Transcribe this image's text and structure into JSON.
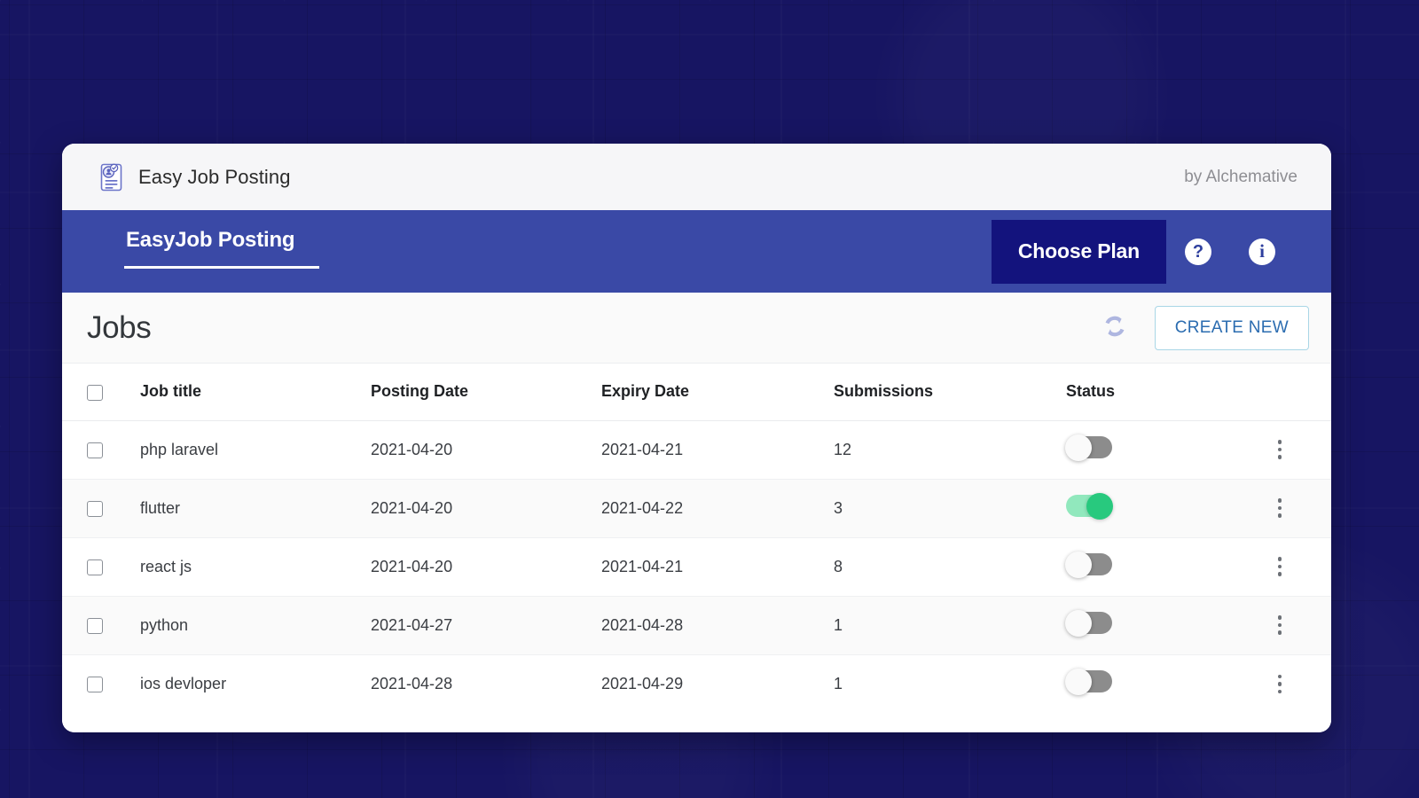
{
  "brand": {
    "logo_icon": "resume-document-icon",
    "app_name": "Easy Job Posting",
    "attribution": "by Alchemative"
  },
  "nav": {
    "active_tab": "EasyJob Posting",
    "choose_plan_label": "Choose Plan",
    "help_icon": "question-mark-icon",
    "help_glyph": "?",
    "info_icon": "info-icon",
    "info_glyph": "i"
  },
  "page": {
    "title": "Jobs",
    "refresh_icon": "refresh-icon",
    "create_label": "CREATE NEW"
  },
  "table": {
    "columns": [
      {
        "key": "select",
        "label": ""
      },
      {
        "key": "title",
        "label": "Job title"
      },
      {
        "key": "posting",
        "label": "Posting Date"
      },
      {
        "key": "expiry",
        "label": "Expiry Date"
      },
      {
        "key": "submissions",
        "label": "Submissions"
      },
      {
        "key": "status",
        "label": "Status"
      },
      {
        "key": "actions",
        "label": ""
      }
    ],
    "header_checkbox_checked": false,
    "rows": [
      {
        "selected": false,
        "title": "php laravel",
        "posting": "2021-04-20",
        "expiry": "2021-04-21",
        "submissions": "12",
        "status_on": false
      },
      {
        "selected": false,
        "title": "flutter",
        "posting": "2021-04-20",
        "expiry": "2021-04-22",
        "submissions": "3",
        "status_on": true
      },
      {
        "selected": false,
        "title": "react js",
        "posting": "2021-04-20",
        "expiry": "2021-04-21",
        "submissions": "8",
        "status_on": false
      },
      {
        "selected": false,
        "title": "python",
        "posting": "2021-04-27",
        "expiry": "2021-04-28",
        "submissions": "1",
        "status_on": false
      },
      {
        "selected": false,
        "title": "ios devloper",
        "posting": "2021-04-28",
        "expiry": "2021-04-29",
        "submissions": "1",
        "status_on": false
      }
    ]
  },
  "colors": {
    "page_background": "#171562",
    "nav_bar": "#3A49A6",
    "plan_button": "#13137D",
    "create_button_text": "#2B6CB0",
    "create_button_border": "#A9D6E6",
    "toggle_on_knob": "#28C97E",
    "toggle_on_track": "#91E8BD",
    "toggle_off_track": "#8C8C8C",
    "refresh_icon": "#AEB6E0"
  }
}
